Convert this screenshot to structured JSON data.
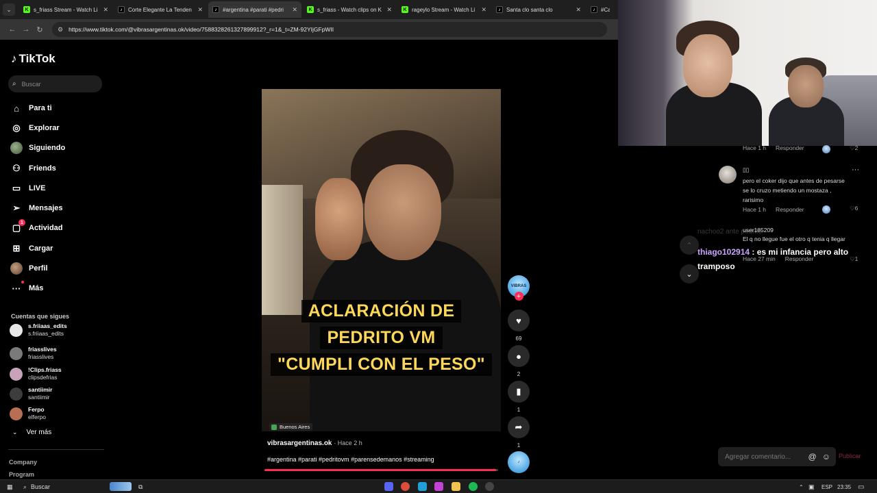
{
  "browser": {
    "tabs": [
      {
        "label": "s_friass Stream - Watch Li",
        "icon": "kick-icon",
        "active": false
      },
      {
        "label": "Corte Elegante La Tenden",
        "icon": "tiktok-icon",
        "active": false
      },
      {
        "label": "#argentina #parati #pedri",
        "icon": "tiktok-icon",
        "active": true
      },
      {
        "label": "s_friass - Watch clips on K",
        "icon": "kick-icon",
        "active": false
      },
      {
        "label": "rageylo Stream - Watch Li",
        "icon": "kick-icon",
        "active": false
      },
      {
        "label": "Santa clo santa clo",
        "icon": "tiktok-icon",
        "active": false
      },
      {
        "label": "#CapC",
        "icon": "tiktok-icon",
        "active": false
      }
    ],
    "url": "https://www.tiktok.com/@vibrasargentinas.ok/video/7588328261327899912?_r=1&_t=ZM-92YIjGFpWII"
  },
  "sidebar": {
    "logo": "TikTok",
    "search_placeholder": "Buscar",
    "nav": [
      {
        "label": "Para ti",
        "icon": "home-icon"
      },
      {
        "label": "Explorar",
        "icon": "compass-icon"
      },
      {
        "label": "Siguiendo",
        "icon": "following-avatar-icon"
      },
      {
        "label": "Friends",
        "icon": "friends-icon"
      },
      {
        "label": "LIVE",
        "icon": "live-icon"
      },
      {
        "label": "Mensajes",
        "icon": "messages-icon"
      },
      {
        "label": "Actividad",
        "icon": "activity-icon",
        "badge": "1"
      },
      {
        "label": "Cargar",
        "icon": "upload-icon"
      },
      {
        "label": "Perfil",
        "icon": "profile-avatar-icon"
      },
      {
        "label": "Más",
        "icon": "more-icon"
      }
    ],
    "following_title": "Cuentas que sigues",
    "following": [
      {
        "name": "s.friiaas_edits",
        "handle": "s.friiaas_edits",
        "color": "#e8e8e8"
      },
      {
        "name": "friasslives",
        "handle": "friasslives",
        "color": "#7a7a7a"
      },
      {
        "name": "!Clips.friass",
        "handle": "clipsdefrias",
        "color": "#c7a2b8"
      },
      {
        "name": "santiimir",
        "handle": "santiimir",
        "color": "#3d3d3d"
      },
      {
        "name": "Ferpo",
        "handle": "elferpo",
        "color": "#b86e52"
      }
    ],
    "ver_mas": "Ver más",
    "footer": [
      "Company",
      "Program"
    ]
  },
  "video": {
    "caption_lines": [
      "ACLARACIÓN DE",
      "PEDRITO VM",
      "\"CUMPLI CON EL PESO\""
    ],
    "location": "Buenos Aires",
    "username": "vibrasargentinas.ok",
    "time": "· Hace 2 h",
    "hashtags": "#argentina #parati #pedritovm #parensedemanos #streaming",
    "progress": 0.99
  },
  "actions": {
    "likes": "69",
    "comments": "2",
    "saves": "1",
    "shares": "1"
  },
  "comments": {
    "first_meta": {
      "time": "Hace 1 h",
      "reply": "Responder",
      "likes": "2"
    },
    "second": {
      "user": "▯▯",
      "text_lines": [
        "pero el coker dijo que antes de pesarse",
        "se lo cruzo metiendo un mostaza ,",
        "rarisimo"
      ],
      "time": "Hace 1 h",
      "reply": "Responder",
      "likes": "6"
    },
    "third": {
      "user": "user185209",
      "text": "El q no llegue fue el otro q tenia q llegar",
      "time": "Hace 27 min",
      "reply": "Responder",
      "likes": "1"
    },
    "chat_ghost": "nachoo2                ante pedrito",
    "chat_user": "thiago102914",
    "chat_text": " : es mi infancia pero alto tramposo",
    "input_placeholder": "Agregar comentario...",
    "publish": "Publicar"
  },
  "taskbar": {
    "search": "Buscar",
    "lang": "ESP",
    "clock": "23:35"
  }
}
